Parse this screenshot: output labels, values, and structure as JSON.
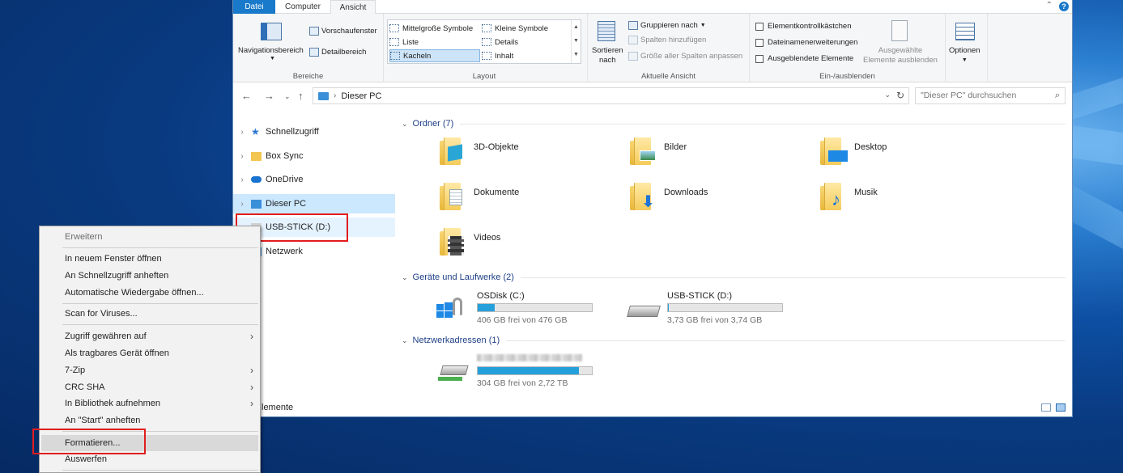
{
  "ribbon": {
    "tabs": [
      "Datei",
      "Computer",
      "Ansicht"
    ],
    "groups": {
      "bereiche": {
        "title": "Bereiche",
        "navigationsbereich": "Navigationsbereich",
        "vorschaufenster": "Vorschaufenster",
        "detailbereich": "Detailbereich"
      },
      "layout": {
        "title": "Layout",
        "options": [
          "Mittelgroße Symbole",
          "Kleine Symbole",
          "Liste",
          "Details",
          "Kacheln",
          "Inhalt"
        ],
        "selected": "Kacheln"
      },
      "aktuelle_ansicht": {
        "title": "Aktuelle Ansicht",
        "sortieren_line1": "Sortieren",
        "sortieren_line2": "nach",
        "gruppieren": "Gruppieren nach",
        "spalten_hinzufuegen": "Spalten hinzufügen",
        "groesse_spalten": "Größe aller Spalten anpassen"
      },
      "ein_ausblenden": {
        "title": "Ein-/ausblenden",
        "checkboxes": [
          "Elementkontrollkästchen",
          "Dateinamenerweiterungen",
          "Ausgeblendete Elemente"
        ],
        "ausgewaehlte_line1": "Ausgewählte",
        "ausgewaehlte_line2": "Elemente ausblenden"
      },
      "optionen": "Optionen"
    }
  },
  "address": {
    "path": "Dieser PC",
    "search_placeholder": "\"Dieser PC\" durchsuchen"
  },
  "nav": {
    "items": [
      "Schnellzugriff",
      "Box Sync",
      "OneDrive",
      "Dieser PC",
      "USB-STICK (D:)",
      "Netzwerk"
    ]
  },
  "content": {
    "groups": {
      "ordner": "Ordner (7)",
      "geraete": "Geräte und Laufwerke (2)",
      "netzwerk": "Netzwerkadressen (1)"
    },
    "folders": [
      "3D-Objekte",
      "Bilder",
      "Desktop",
      "Dokumente",
      "Downloads",
      "Musik",
      "Videos"
    ],
    "drives": [
      {
        "name": "OSDisk (C:)",
        "free": "406 GB frei von 476 GB",
        "used_fraction": 0.15
      },
      {
        "name": "USB-STICK (D:)",
        "free": "3,73 GB frei von 3,74 GB",
        "used_fraction": 0.003
      }
    ],
    "network": {
      "free": "304 GB frei von 2,72 TB",
      "used_fraction": 0.89
    }
  },
  "status": {
    "text": "lemente"
  },
  "context_menu": {
    "header": "Erweitern",
    "items": [
      "In neuem Fenster öffnen",
      "An Schnellzugriff anheften",
      "Automatische Wiedergabe öffnen...",
      "Scan for Viruses...",
      "Zugriff gewähren auf",
      "Als tragbares Gerät öffnen",
      "7-Zip",
      "CRC SHA",
      "In Bibliothek aufnehmen",
      "An \"Start\" anheften",
      "Formatieren...",
      "Auswerfen"
    ]
  },
  "colors": {
    "accent": "#1979ca",
    "selection": "#cce8ff",
    "highlight_box": "#e01e1e",
    "drive_bar": "#26a0da"
  }
}
